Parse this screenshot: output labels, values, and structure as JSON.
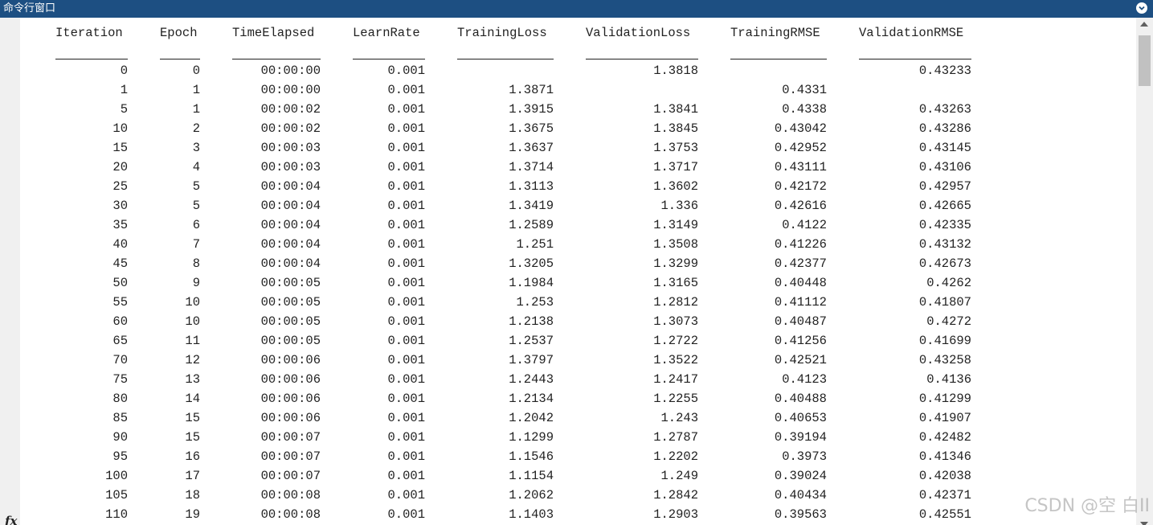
{
  "window": {
    "title": "命令行窗口",
    "fx_label": "fx"
  },
  "watermark": "CSDN @空 白II",
  "table": {
    "headers": [
      "Iteration",
      "Epoch",
      "TimeElapsed",
      "LearnRate",
      "TrainingLoss",
      "ValidationLoss",
      "TrainingRMSE",
      "ValidationRMSE"
    ],
    "rows": [
      [
        "0",
        "0",
        "00:00:00",
        "0.001",
        "",
        "1.3818",
        "",
        "0.43233"
      ],
      [
        "1",
        "1",
        "00:00:00",
        "0.001",
        "1.3871",
        "",
        "0.4331",
        ""
      ],
      [
        "5",
        "1",
        "00:00:02",
        "0.001",
        "1.3915",
        "1.3841",
        "0.4338",
        "0.43263"
      ],
      [
        "10",
        "2",
        "00:00:02",
        "0.001",
        "1.3675",
        "1.3845",
        "0.43042",
        "0.43286"
      ],
      [
        "15",
        "3",
        "00:00:03",
        "0.001",
        "1.3637",
        "1.3753",
        "0.42952",
        "0.43145"
      ],
      [
        "20",
        "4",
        "00:00:03",
        "0.001",
        "1.3714",
        "1.3717",
        "0.43111",
        "0.43106"
      ],
      [
        "25",
        "5",
        "00:00:04",
        "0.001",
        "1.3113",
        "1.3602",
        "0.42172",
        "0.42957"
      ],
      [
        "30",
        "5",
        "00:00:04",
        "0.001",
        "1.3419",
        "1.336",
        "0.42616",
        "0.42665"
      ],
      [
        "35",
        "6",
        "00:00:04",
        "0.001",
        "1.2589",
        "1.3149",
        "0.4122",
        "0.42335"
      ],
      [
        "40",
        "7",
        "00:00:04",
        "0.001",
        "1.251",
        "1.3508",
        "0.41226",
        "0.43132"
      ],
      [
        "45",
        "8",
        "00:00:04",
        "0.001",
        "1.3205",
        "1.3299",
        "0.42377",
        "0.42673"
      ],
      [
        "50",
        "9",
        "00:00:05",
        "0.001",
        "1.1984",
        "1.3165",
        "0.40448",
        "0.4262"
      ],
      [
        "55",
        "10",
        "00:00:05",
        "0.001",
        "1.253",
        "1.2812",
        "0.41112",
        "0.41807"
      ],
      [
        "60",
        "10",
        "00:00:05",
        "0.001",
        "1.2138",
        "1.3073",
        "0.40487",
        "0.4272"
      ],
      [
        "65",
        "11",
        "00:00:05",
        "0.001",
        "1.2537",
        "1.2722",
        "0.41256",
        "0.41699"
      ],
      [
        "70",
        "12",
        "00:00:06",
        "0.001",
        "1.3797",
        "1.3522",
        "0.42521",
        "0.43258"
      ],
      [
        "75",
        "13",
        "00:00:06",
        "0.001",
        "1.2443",
        "1.2417",
        "0.4123",
        "0.4136"
      ],
      [
        "80",
        "14",
        "00:00:06",
        "0.001",
        "1.2134",
        "1.2255",
        "0.40488",
        "0.41299"
      ],
      [
        "85",
        "15",
        "00:00:06",
        "0.001",
        "1.2042",
        "1.243",
        "0.40653",
        "0.41907"
      ],
      [
        "90",
        "15",
        "00:00:07",
        "0.001",
        "1.1299",
        "1.2787",
        "0.39194",
        "0.42482"
      ],
      [
        "95",
        "16",
        "00:00:07",
        "0.001",
        "1.1546",
        "1.2202",
        "0.3973",
        "0.41346"
      ],
      [
        "100",
        "17",
        "00:00:07",
        "0.001",
        "1.1154",
        "1.249",
        "0.39024",
        "0.42038"
      ],
      [
        "105",
        "18",
        "00:00:08",
        "0.001",
        "1.2062",
        "1.2842",
        "0.40434",
        "0.42371"
      ],
      [
        "110",
        "19",
        "00:00:08",
        "0.001",
        "1.1403",
        "1.2903",
        "0.39563",
        "0.42551"
      ]
    ]
  }
}
